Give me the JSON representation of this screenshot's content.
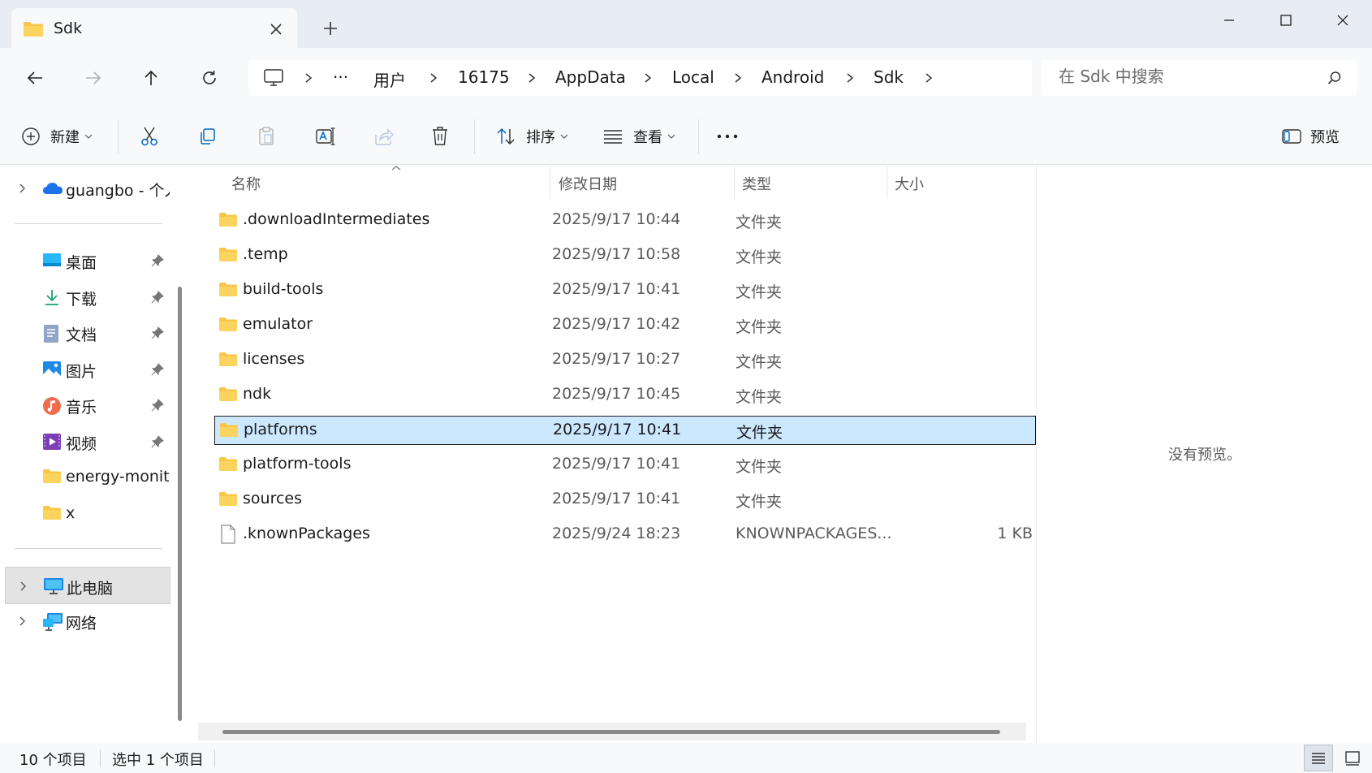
{
  "window": {
    "tab_title": "Sdk",
    "new_tab_label": "+"
  },
  "breadcrumb": {
    "more": "···",
    "items": [
      "用户",
      "16175",
      "AppData",
      "Local",
      "Android",
      "Sdk"
    ]
  },
  "search": {
    "placeholder": "在 Sdk 中搜索"
  },
  "toolbar": {
    "new_label": "新建",
    "sort_label": "排序",
    "view_label": "查看",
    "preview_label": "预览"
  },
  "sidebar": {
    "cloud": {
      "label": "guangbo - 个人"
    },
    "quick_access": [
      {
        "label": "桌面",
        "icon": "desktop-icon"
      },
      {
        "label": "下载",
        "icon": "download-icon"
      },
      {
        "label": "文档",
        "icon": "documents-icon"
      },
      {
        "label": "图片",
        "icon": "pictures-icon"
      },
      {
        "label": "音乐",
        "icon": "music-icon"
      },
      {
        "label": "视频",
        "icon": "videos-icon"
      },
      {
        "label": "energy-monitor",
        "icon": "folder-icon"
      },
      {
        "label": "x",
        "icon": "folder-icon"
      }
    ],
    "this_pc": {
      "label": "此电脑"
    },
    "network": {
      "label": "网络"
    }
  },
  "columns": {
    "name": "名称",
    "date": "修改日期",
    "type": "类型",
    "size": "大小"
  },
  "files": [
    {
      "name": ".downloadIntermediates",
      "date": "2025/9/17 10:44",
      "type": "文件夹",
      "size": "",
      "kind": "folder"
    },
    {
      "name": ".temp",
      "date": "2025/9/17 10:58",
      "type": "文件夹",
      "size": "",
      "kind": "folder"
    },
    {
      "name": "build-tools",
      "date": "2025/9/17 10:41",
      "type": "文件夹",
      "size": "",
      "kind": "folder"
    },
    {
      "name": "emulator",
      "date": "2025/9/17 10:42",
      "type": "文件夹",
      "size": "",
      "kind": "folder"
    },
    {
      "name": "licenses",
      "date": "2025/9/17 10:27",
      "type": "文件夹",
      "size": "",
      "kind": "folder"
    },
    {
      "name": "ndk",
      "date": "2025/9/17 10:45",
      "type": "文件夹",
      "size": "",
      "kind": "folder"
    },
    {
      "name": "platforms",
      "date": "2025/9/17 10:41",
      "type": "文件夹",
      "size": "",
      "kind": "folder",
      "selected": true
    },
    {
      "name": "platform-tools",
      "date": "2025/9/17 10:41",
      "type": "文件夹",
      "size": "",
      "kind": "folder"
    },
    {
      "name": "sources",
      "date": "2025/9/17 10:41",
      "type": "文件夹",
      "size": "",
      "kind": "folder"
    },
    {
      "name": ".knownPackages",
      "date": "2025/9/24 18:23",
      "type": "KNOWNPACKAGES...",
      "size": "1 KB",
      "kind": "file"
    }
  ],
  "preview": {
    "empty_text": "没有预览。"
  },
  "status": {
    "item_count": "10 个项目",
    "selected_count": "选中 1 个项目"
  },
  "colors": {
    "selection": "#cce8ff",
    "folder": "#f8c74a",
    "accent": "#0067c0"
  }
}
